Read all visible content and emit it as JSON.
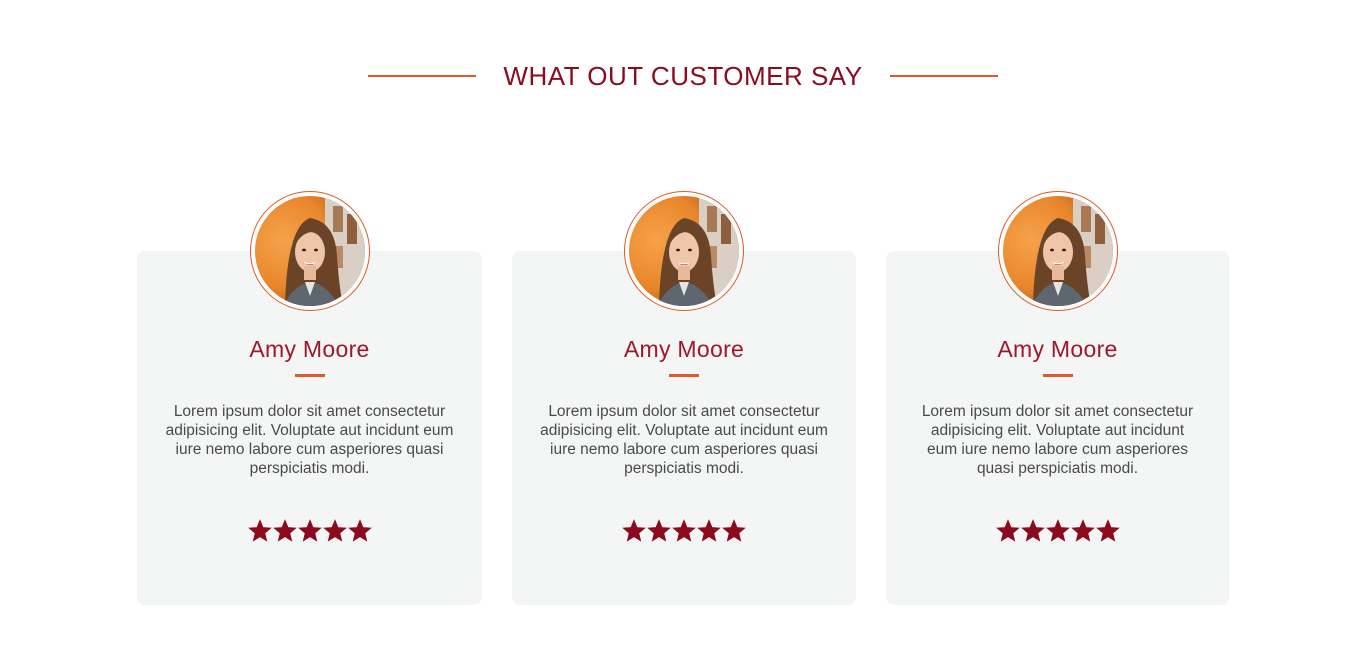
{
  "section": {
    "title": "WHAT OUT CUSTOMER SAY"
  },
  "colors": {
    "accent": "#e0592a",
    "brand": "#8b0a1e",
    "card_bg": "#f4f5f5",
    "star": "#8b0a1e"
  },
  "testimonials": [
    {
      "name": "Amy Moore",
      "text": "Lorem ipsum dolor sit amet consectetur adipisicing elit. Voluptate aut incidunt eum iure nemo labore cum asperiores quasi perspiciatis modi.",
      "rating": 5,
      "rating_max": 5,
      "avatar_icon": "woman-portrait"
    },
    {
      "name": "Amy Moore",
      "text": "Lorem ipsum dolor sit amet consectetur adipisicing elit. Voluptate aut incidunt eum iure nemo labore cum asperiores quasi perspiciatis modi.",
      "rating": 5,
      "rating_max": 5,
      "avatar_icon": "woman-portrait"
    },
    {
      "name": "Amy Moore",
      "text": "Lorem ipsum dolor sit amet consectetur adipisicing elit. Voluptate aut incidunt eum iure nemo labore cum asperiores quasi perspiciatis modi.",
      "rating": 5,
      "rating_max": 5,
      "avatar_icon": "woman-portrait"
    }
  ]
}
